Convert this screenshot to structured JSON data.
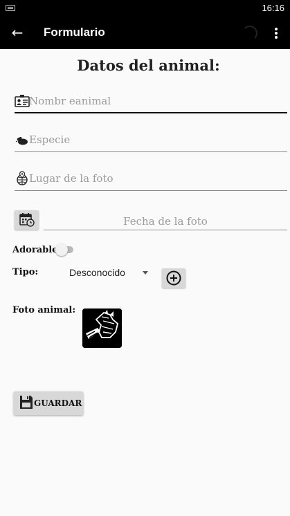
{
  "status_bar": {
    "time": "16:16",
    "keyboard_icon": "keyboard-icon"
  },
  "app_bar": {
    "title": "Formulario",
    "back_icon": "arrow-back-icon",
    "more_icon": "more-vert-icon"
  },
  "form": {
    "heading": "Datos del animal:",
    "name_placeholder": "Nombr eanimal",
    "species_placeholder": "Especie",
    "location_placeholder": "Lugar de la foto",
    "date_placeholder": "Fecha de la foto",
    "adorable_label": "Adorable",
    "adorable_on": false,
    "type_label": "Tipo:",
    "type_value": "Desconocido",
    "photo_label": "Foto animal:",
    "save_label": "GUARDAR"
  },
  "colors": {
    "bar": "#000000",
    "background": "#fafafa",
    "button": "#d8d8d8",
    "placeholder": "#9a9a9a"
  }
}
